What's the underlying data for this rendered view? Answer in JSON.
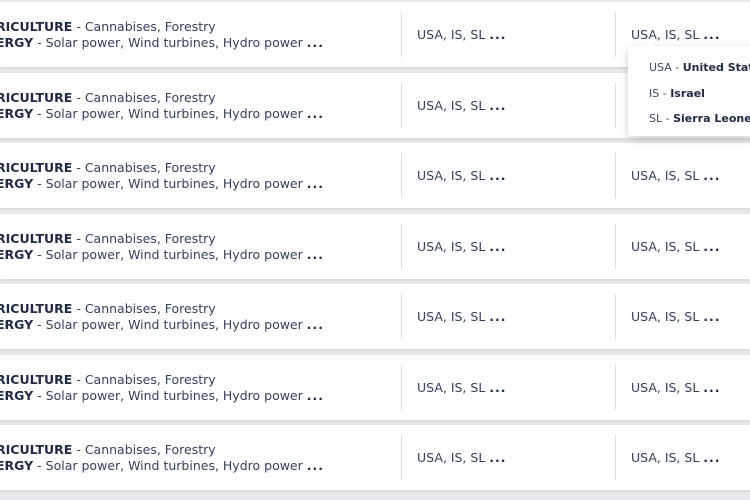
{
  "rows": [
    {
      "sectors": [
        {
          "name": "RICULTURE",
          "detail": "Cannabises, Forestry",
          "more": ""
        },
        {
          "name": "ERGY",
          "detail": "Solar power, Wind turbines, Hydro power",
          "more": "..."
        }
      ],
      "col2": {
        "text": "USA, IS, SL",
        "more": "..."
      },
      "col3": {
        "text": "USA, IS, SL",
        "more": "..."
      }
    },
    {
      "sectors": [
        {
          "name": "RICULTURE",
          "detail": "Cannabises, Forestry",
          "more": ""
        },
        {
          "name": "ERGY",
          "detail": "Solar power, Wind turbines, Hydro power",
          "more": "..."
        }
      ],
      "col2": {
        "text": "USA, IS, SL",
        "more": "..."
      },
      "col3": {
        "text": "",
        "more": ""
      }
    },
    {
      "sectors": [
        {
          "name": "RICULTURE",
          "detail": "Cannabises, Forestry",
          "more": ""
        },
        {
          "name": "ERGY",
          "detail": "Solar power, Wind turbines, Hydro power",
          "more": "..."
        }
      ],
      "col2": {
        "text": "USA, IS, SL",
        "more": "..."
      },
      "col3": {
        "text": "USA, IS, SL",
        "more": "..."
      }
    },
    {
      "sectors": [
        {
          "name": "RICULTURE",
          "detail": "Cannabises, Forestry",
          "more": ""
        },
        {
          "name": "ERGY",
          "detail": "Solar power, Wind turbines, Hydro power",
          "more": "..."
        }
      ],
      "col2": {
        "text": "USA, IS, SL",
        "more": "..."
      },
      "col3": {
        "text": "USA, IS, SL",
        "more": "..."
      }
    },
    {
      "sectors": [
        {
          "name": "RICULTURE",
          "detail": "Cannabises, Forestry",
          "more": ""
        },
        {
          "name": "ERGY",
          "detail": "Solar power, Wind turbines, Hydro power",
          "more": "..."
        }
      ],
      "col2": {
        "text": "USA, IS, SL",
        "more": "..."
      },
      "col3": {
        "text": "USA, IS, SL",
        "more": "..."
      }
    },
    {
      "sectors": [
        {
          "name": "RICULTURE",
          "detail": "Cannabises, Forestry",
          "more": ""
        },
        {
          "name": "ERGY",
          "detail": "Solar power, Wind turbines, Hydro power",
          "more": "..."
        }
      ],
      "col2": {
        "text": "USA, IS, SL",
        "more": "..."
      },
      "col3": {
        "text": "USA, IS, SL",
        "more": "..."
      }
    },
    {
      "sectors": [
        {
          "name": "RICULTURE",
          "detail": "Cannabises, Forestry",
          "more": ""
        },
        {
          "name": "ERGY",
          "detail": "Solar power, Wind turbines, Hydro power",
          "more": "..."
        }
      ],
      "col2": {
        "text": "USA, IS, SL",
        "more": "..."
      },
      "col3": {
        "text": "USA, IS, SL",
        "more": "..."
      }
    }
  ],
  "country_popup": {
    "items": [
      {
        "code": "USA",
        "name": "United States"
      },
      {
        "code": "IS",
        "name": "Israel"
      },
      {
        "code": "SL",
        "name": "Sierra Leone"
      }
    ]
  },
  "colors": {
    "background": "#e6e8ec",
    "row": "#ffffff",
    "text": "#33415a",
    "bold_text": "#1f2a44",
    "divider": "#dadde3"
  }
}
